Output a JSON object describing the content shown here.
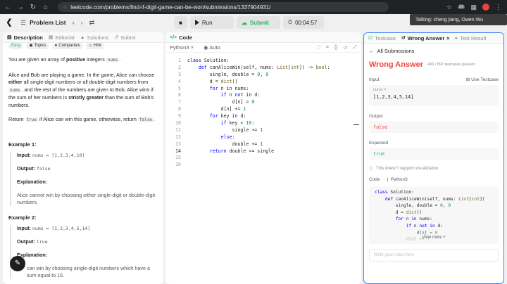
{
  "browser": {
    "url": "leetcode.com/problems/find-if-digit-game-can-be-won/submissions/1337904931/",
    "zoom_toast": "Talking: cheng jiang, Owen Wu",
    "ext_badge": "26"
  },
  "nav": {
    "problem_list": "Problem List",
    "run": "Run",
    "submit": "Submit",
    "timer": "00:04:57"
  },
  "desc": {
    "tabs": [
      {
        "label": "Description"
      },
      {
        "label": "Editorial"
      },
      {
        "label": "Solutions"
      },
      {
        "label": "Submi"
      }
    ],
    "tags": [
      "Easy",
      "Topics",
      "Companies",
      "Hint"
    ],
    "p1_a": "You are given an array of ",
    "p1_b": "positive",
    "p1_c": " integers ",
    "p1_code": "nums",
    "p1_d": ".",
    "p2_a": "Alice and Bob are playing a game. In the game, Alice can choose ",
    "p2_b": "either",
    "p2_c": " all single-digit numbers or all double-digit numbers from ",
    "p2_code": "nums",
    "p2_d": ", and the rest of the numbers are given to Bob. Alice wins if the sum of her numbers is ",
    "p2_e": "strictly greater",
    "p2_f": " than the sum of Bob's numbers.",
    "p3_a": "Return ",
    "p3_code1": "true",
    "p3_b": " if Alice can win this game, otherwise, return ",
    "p3_code2": "false",
    "p3_c": ".",
    "ex1_title": "Example 1:",
    "ex1_input_label": "Input:",
    "ex1_input": "nums = [1,2,3,4,10]",
    "ex1_output_label": "Output:",
    "ex1_output": "false",
    "ex1_expl_label": "Explanation:",
    "ex1_expl": "Alice cannot win by choosing either single-digit or double-digit numbers.",
    "ex2_title": "Example 2:",
    "ex2_input_label": "Input:",
    "ex2_input": "nums = [1,2,3,4,5,14]",
    "ex2_output_label": "Output:",
    "ex2_output": "true",
    "ex2_expl_label": "Explanation:",
    "ex2_expl": "can win by choosing single-digit numbers which have a sum equal to 16."
  },
  "code": {
    "title": "Code",
    "lang": "Python3",
    "mode": "Auto",
    "lines": [
      "class Solution:",
      "    def canAliceWin(self, nums: List[int]) -> bool:",
      "        single, double = 0, 0",
      "        d = dict()",
      "        for n in nums:",
      "            if n not in d:",
      "                d[n] = 0",
      "            d[n] += 1",
      "        for key in d:",
      "            if key < 10:",
      "                single += 1",
      "            else:",
      "                double += 1",
      "        return double >= single",
      "",
      ""
    ]
  },
  "result": {
    "tabs": [
      {
        "label": "Testcase"
      },
      {
        "label": "Wrong Answer"
      },
      {
        "label": "Test Result"
      }
    ],
    "all_submissions": "All Submissions",
    "verdict": "Wrong Answer",
    "count": "406 / 897 testcases passed",
    "input_label": "Input",
    "use_testcase": "Use Testcase",
    "input_name": "nums =",
    "input_value": "[1,2,3,4,5,14]",
    "output_label": "Output",
    "output_value": "false",
    "expected_label": "Expected",
    "expected_value": "true",
    "viz_note": "This doesn't support visualization",
    "code_label": "Code",
    "code_lang": "Python3",
    "code_lines": [
      "class Solution:",
      "    def canAliceWin(self, nums: List[int])",
      "        single, double = 0, 0",
      "        d = dict()",
      "        for n in nums:",
      "            if n not in d:",
      "                d[n] = 0",
      "            d[n] += 1"
    ],
    "see_more": "View more",
    "notes_placeholder": "Write your notes here"
  }
}
